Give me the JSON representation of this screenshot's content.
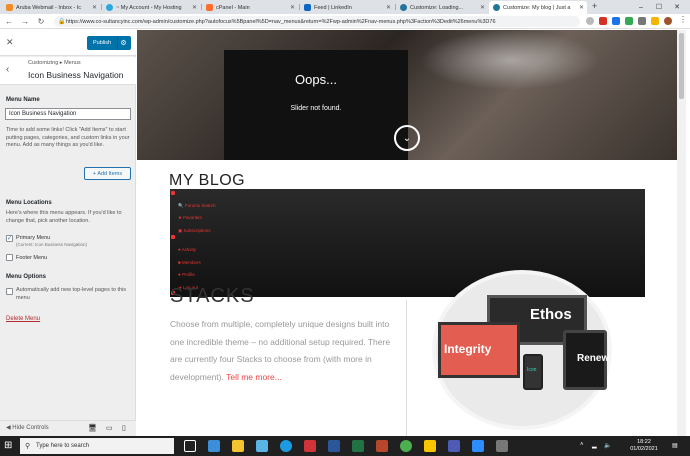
{
  "browser": {
    "tabs": [
      {
        "label": "Aruba Webmail - Inbox - Ic",
        "color": "#f28c28"
      },
      {
        "label": "~ My Account - My Hosting",
        "color": "#2aa7e0"
      },
      {
        "label": "cPanel - Main",
        "color": "#ff6c2c"
      },
      {
        "label": "Feed | LinkedIn",
        "color": "#0a66c2"
      },
      {
        "label": "Customize: Loading...",
        "color": "#21759b"
      },
      {
        "label": "Customize: My blog | Just a",
        "color": "#21759b"
      }
    ],
    "new_tab": "+",
    "window_controls": {
      "minimize": "–",
      "maximize": "☐",
      "close": "✕"
    },
    "url": "https://www.co-sultancyinc.com/wp-admin/customize.php?autofocus%5Bpanel%5D=nav_menus&return=%2Fwp-admin%2Fnav-menus.php%3Faction%3Dedit%26menu%3D76",
    "menu_glyph": "⋮"
  },
  "customizer": {
    "publish_label": "Publish",
    "breadcrumb": "Customizing  ▸  Menus",
    "panel_title": "Icon Business Navigation",
    "menu_name_label": "Menu Name",
    "menu_name_value": "Icon Business Navigation",
    "help_text": "Time to add some links! Click \"Add Items\" to start putting pages, categories, and custom links in your menu. Add as many things as you'd like.",
    "add_items_label": "+ Add Items",
    "menu_locations_label": "Menu Locations",
    "menu_locations_help": "Here's where this menu appears. If you'd like to change that, pick another location.",
    "primary_menu_label": "Primary Menu",
    "primary_menu_note": "(Current: Icon Business Navigation)",
    "footer_menu_label": "Footer Menu",
    "menu_options_label": "Menu Options",
    "auto_add_label": "Automatically add new top-level pages to this menu",
    "delete_label": "Delete Menu",
    "hide_controls_label": "Hide Controls"
  },
  "preview": {
    "oops": "Oops...",
    "slider_not_found": "Slider not found.",
    "blog_title": "MY BLOG",
    "menu_items": [
      "Forums Search",
      "Favorites",
      "Subscriptions",
      "Activity",
      "Members",
      "Profile",
      "Log out"
    ],
    "stacks_heading": "STACKS",
    "stacks_text": "Choose from multiple, completely unique designs built into one incredible theme – no additional setup required. There are currently four Stacks to choose from (with more in development).",
    "tell_more": "Tell me more...",
    "stack_names": {
      "ethos": "Ethos",
      "integrity": "Integrity",
      "icon": "Icon",
      "renew": "Renew"
    }
  },
  "taskbar": {
    "search_placeholder": "Type here to search",
    "time": "18:22",
    "date": "01/02/2021"
  }
}
